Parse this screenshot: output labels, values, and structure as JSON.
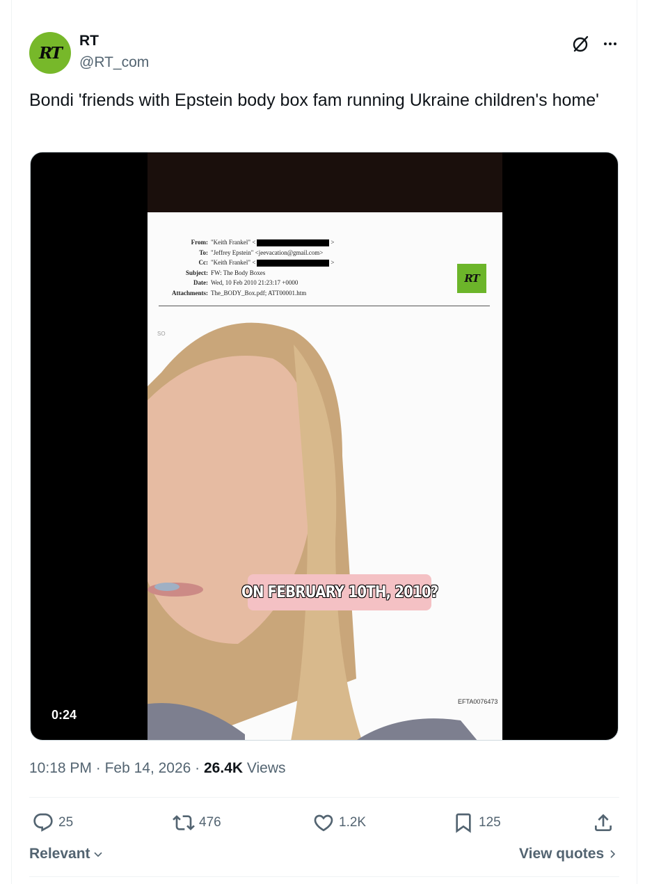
{
  "author": {
    "avatar_text": "RT",
    "name": "RT",
    "handle": "@RT_com"
  },
  "tweet": {
    "text": "Bondi 'friends with Epstein body box fam running Ukraine children's home'"
  },
  "media": {
    "duration": "0:24",
    "caption": "ON FEBRUARY 10TH, 2010?",
    "badge_text": "RT",
    "document": {
      "from_label": "From:",
      "from_value": "\"Keith Frankel\" <",
      "to_label": "To:",
      "to_value": "\"Jeffrey Epstein\" <jeevacation@gmail.com>",
      "cc_label": "Cc:",
      "cc_value": "\"Keith Frankel\" <",
      "subject_label": "Subject:",
      "subject_value": "FW: The Body Boxes",
      "date_label": "Date:",
      "date_value": "Wed, 10 Feb 2010 21:23:17 +0000",
      "attachments_label": "Attachments:",
      "attachments_value": "The_BODY_Box.pdf; ATT00001.htm",
      "fragment": "SO",
      "footer_id": "EFTA0076473"
    }
  },
  "meta": {
    "time": "10:18 PM",
    "separator": " · ",
    "date": "Feb 14, 2026",
    "views_count": "26.4K",
    "views_label": " Views"
  },
  "actions": {
    "replies": "25",
    "reposts": "476",
    "likes": "1.2K",
    "bookmarks": "125"
  },
  "footer": {
    "sort_label": "Relevant",
    "view_quotes_label": "View quotes"
  },
  "colors": {
    "brand_green": "#77b82a",
    "secondary_text": "#536471",
    "primary_text": "#0f1419"
  }
}
